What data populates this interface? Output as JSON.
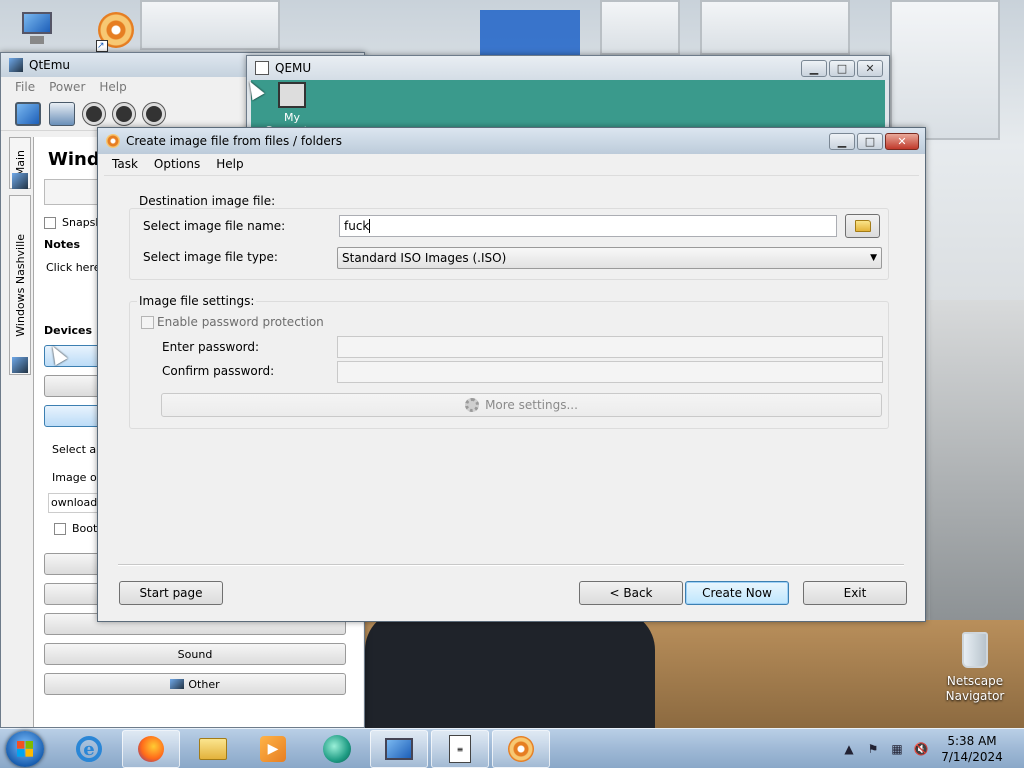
{
  "desktop": {
    "recycle_bin_label": "Netscape Navigator"
  },
  "qtemu": {
    "title": "QtEmu",
    "menu": [
      "File",
      "Power",
      "Help"
    ],
    "tabs": [
      "Main",
      "Windows Nashville"
    ],
    "panel_title": "Windo",
    "snapshot_label": "Snapsh",
    "notes_label": "Notes",
    "notes_text": "Click here t",
    "devices_label": "Devices",
    "select_text": "Select a v",
    "image_text": "Image or",
    "download_value": "ownloads",
    "boot_label": "Boot",
    "sound_label": "Sound",
    "other_label": "Other"
  },
  "qemu": {
    "title": "QEMU",
    "desktop_icon_label": "My Computer"
  },
  "dialog": {
    "title": "Create image file from files / folders",
    "menu": [
      "Task",
      "Options",
      "Help"
    ],
    "destination_group": "Destination image file:",
    "file_name_label": "Select image file name:",
    "file_name_value": "fuck",
    "file_type_label": "Select image file type:",
    "file_type_value": "Standard ISO Images (.ISO)",
    "settings_group": "Image file settings:",
    "enable_password_label": "Enable password protection",
    "enter_password_label": "Enter password:",
    "confirm_password_label": "Confirm password:",
    "more_settings_label": "More settings...",
    "start_page_label": "Start page",
    "back_label": "< Back",
    "create_now_label": "Create Now",
    "exit_label": "Exit"
  },
  "taskbar": {
    "clock_time": "5:38 AM",
    "clock_date": "7/14/2024",
    "items": [
      "internet-explorer",
      "firefox",
      "file-explorer",
      "media-player",
      "browser-globe",
      "qemu-monitor",
      "document",
      "poweriso"
    ]
  }
}
